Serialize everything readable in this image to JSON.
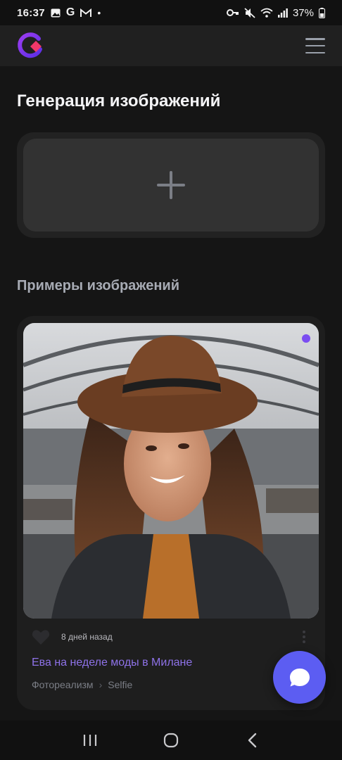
{
  "status_bar": {
    "time": "16:37",
    "battery": "37%",
    "left_icons": [
      "gallery-icon",
      "google-icon",
      "gmail-icon",
      "dot-icon"
    ],
    "right_icons": [
      "key-icon",
      "mute-icon",
      "wifi-icon",
      "signal-icon",
      "battery-icon"
    ],
    "google_letter": "G",
    "dot": "•"
  },
  "header": {
    "logo": "app-logo",
    "menu_icon": "hamburger-icon"
  },
  "page": {
    "title": "Генерация изображений"
  },
  "upload": {
    "icon": "plus-icon"
  },
  "examples": {
    "title": "Примеры изображений",
    "card": {
      "time_ago": "8 дней назад",
      "title": "Ева на неделе моды в Милане",
      "tags": [
        "Фотореализм",
        "Selfie"
      ],
      "tag_separator": "›"
    }
  },
  "fab": {
    "icon": "chat-icon"
  },
  "nav": {
    "buttons": [
      "recent-apps-icon",
      "home-icon",
      "back-icon"
    ]
  },
  "colors": {
    "background": "#151515",
    "accent": "#5c5df2",
    "link": "#8e72e8",
    "indicator": "#7b4df1"
  }
}
